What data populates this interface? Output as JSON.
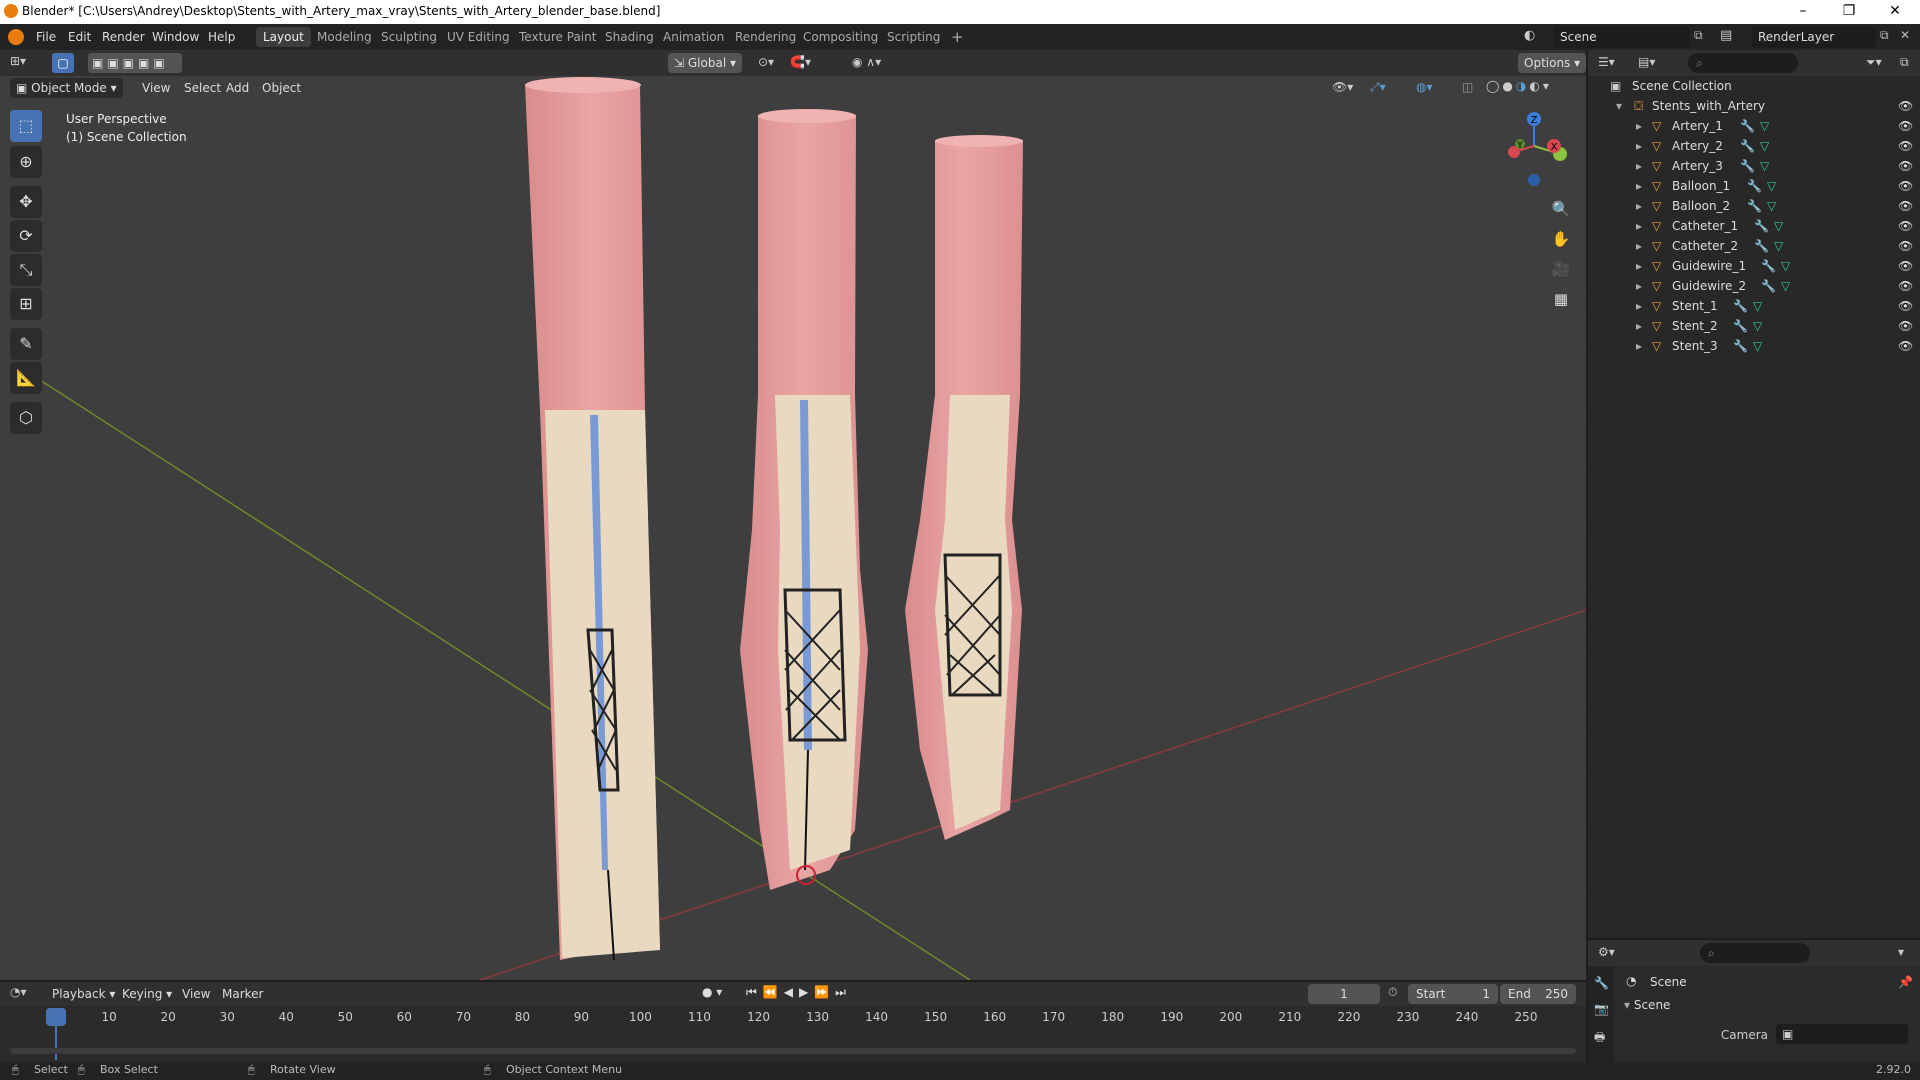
{
  "window": {
    "title": "Blender* [C:\\Users\\Andrey\\Desktop\\Stents_with_Artery_max_vray\\Stents_with_Artery_blender_base.blend]"
  },
  "menu": {
    "items": [
      "File",
      "Edit",
      "Render",
      "Window",
      "Help"
    ]
  },
  "workspaces": [
    "Layout",
    "Modeling",
    "Sculpting",
    "UV Editing",
    "Texture Paint",
    "Shading",
    "Animation",
    "Rendering",
    "Compositing",
    "Scripting"
  ],
  "active_workspace": "Layout",
  "scene_name": "Scene",
  "view_layer": "RenderLayer",
  "viewport": {
    "mode": "Object Mode",
    "menus": [
      "View",
      "Select",
      "Add",
      "Object"
    ],
    "transform_orientation": "Global",
    "options_label": "Options",
    "overlay_title": "User Perspective",
    "overlay_collection": "(1) Scene Collection",
    "gizmo_axes": {
      "x": "X",
      "y": "Y",
      "z": "Z"
    }
  },
  "outliner": {
    "root": "Scene Collection",
    "collection": "Stents_with_Artery",
    "objects": [
      "Artery_1",
      "Artery_2",
      "Artery_3",
      "Balloon_1",
      "Balloon_2",
      "Catheter_1",
      "Catheter_2",
      "Guidewire_1",
      "Guidewire_2",
      "Stent_1",
      "Stent_2",
      "Stent_3"
    ]
  },
  "properties": {
    "header": "Scene",
    "panel": "Scene",
    "camera_label": "Camera"
  },
  "timeline": {
    "menus": [
      "Playback",
      "Keying",
      "View",
      "Marker"
    ],
    "current_frame": "1",
    "start_label": "Start",
    "start": "1",
    "end_label": "End",
    "end": "250",
    "ticks": [
      "1",
      "10",
      "20",
      "30",
      "40",
      "50",
      "60",
      "70",
      "80",
      "90",
      "100",
      "110",
      "120",
      "130",
      "140",
      "150",
      "160",
      "170",
      "180",
      "190",
      "200",
      "210",
      "220",
      "230",
      "240",
      "250"
    ]
  },
  "statusbar": {
    "select": "Select",
    "box_select": "Box Select",
    "rotate_view": "Rotate View",
    "context_menu": "Object Context Menu",
    "version": "2.92.0"
  },
  "colors": {
    "artery": "#e6a0a0",
    "inner": "#e9dcc6",
    "stent": "#222222",
    "guidewire": "#7a9ad6",
    "accent": "#4772b3"
  }
}
